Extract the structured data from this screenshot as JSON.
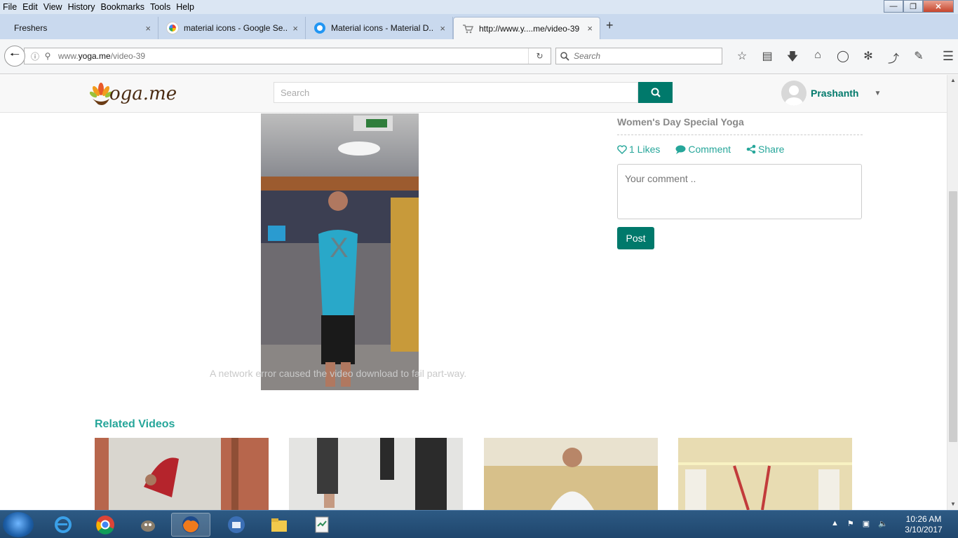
{
  "menubar": {
    "items": [
      "File",
      "Edit",
      "View",
      "History",
      "Bookmarks",
      "Tools",
      "Help"
    ]
  },
  "tabs": [
    {
      "title": "Freshers",
      "close": "×"
    },
    {
      "title": "material icons - Google Se...",
      "close": "×"
    },
    {
      "title": "Material icons - Material D...",
      "close": "×"
    },
    {
      "title": "http://www.y....me/video-39",
      "close": "×",
      "active": true
    }
  ],
  "newtab_label": "+",
  "navbar": {
    "url_prefix": "www.",
    "url_domain": "yoga.me",
    "url_path": "/video-39",
    "search_placeholder": "Search"
  },
  "site": {
    "logo_text": "oga.me",
    "search_placeholder": "Search",
    "user_name": "Prashanth",
    "brand_color": "#00796b",
    "accent_color": "#26a69a"
  },
  "video": {
    "close_glyph": "X",
    "error_message": "A network error caused the video download to fail part-way."
  },
  "post": {
    "title": "Women's Day Special Yoga",
    "likes_label": "1 Likes",
    "comment_label": "Comment",
    "share_label": "Share",
    "comment_placeholder": "Your comment ..",
    "post_button": "Post"
  },
  "related": {
    "heading": "Related Videos",
    "thumbs": [
      "related-video-1",
      "related-video-2",
      "related-video-3",
      "related-video-4"
    ]
  },
  "taskbar": {
    "time": "10:26 AM",
    "date": "3/10/2017"
  }
}
